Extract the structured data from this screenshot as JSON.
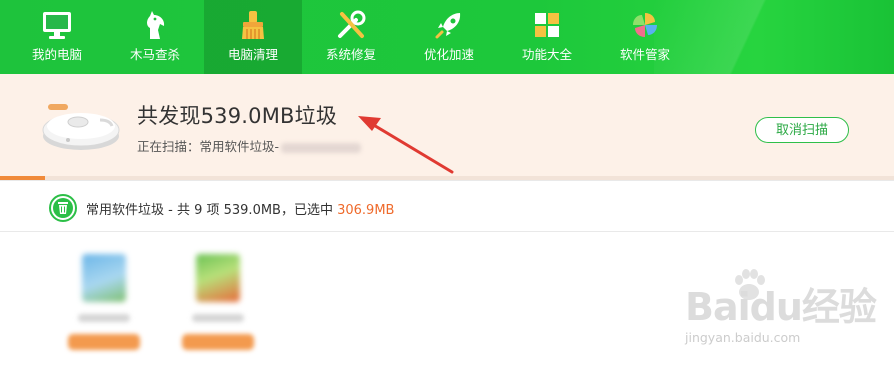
{
  "nav": {
    "items": [
      {
        "label": "我的电脑",
        "icon": "monitor-icon",
        "active": false
      },
      {
        "label": "木马查杀",
        "icon": "horse-icon",
        "active": false
      },
      {
        "label": "电脑清理",
        "icon": "broom-icon",
        "active": true
      },
      {
        "label": "系统修复",
        "icon": "wrench-icon",
        "active": false
      },
      {
        "label": "优化加速",
        "icon": "rocket-icon",
        "active": false
      },
      {
        "label": "功能大全",
        "icon": "grid-icon",
        "active": false
      },
      {
        "label": "软件管家",
        "icon": "flower-icon",
        "active": false
      }
    ]
  },
  "scan": {
    "title": "共发现539.0MB垃圾",
    "status_prefix": "正在扫描：常用软件垃圾-",
    "cancel_label": "取消扫描",
    "progress": 0.05
  },
  "category": {
    "prefix": "常用软件垃圾 - 共 9 项 539.0MB，已选中 ",
    "selected": "306.9MB"
  },
  "watermark": {
    "main": "Baidu经验",
    "sub": "jingyan.baidu.com"
  },
  "colors": {
    "nav_green": "#1ec33c",
    "accent_orange": "#ef6a2b",
    "banner_bg": "#fdf1e8",
    "arrow_red": "#e03a32"
  }
}
